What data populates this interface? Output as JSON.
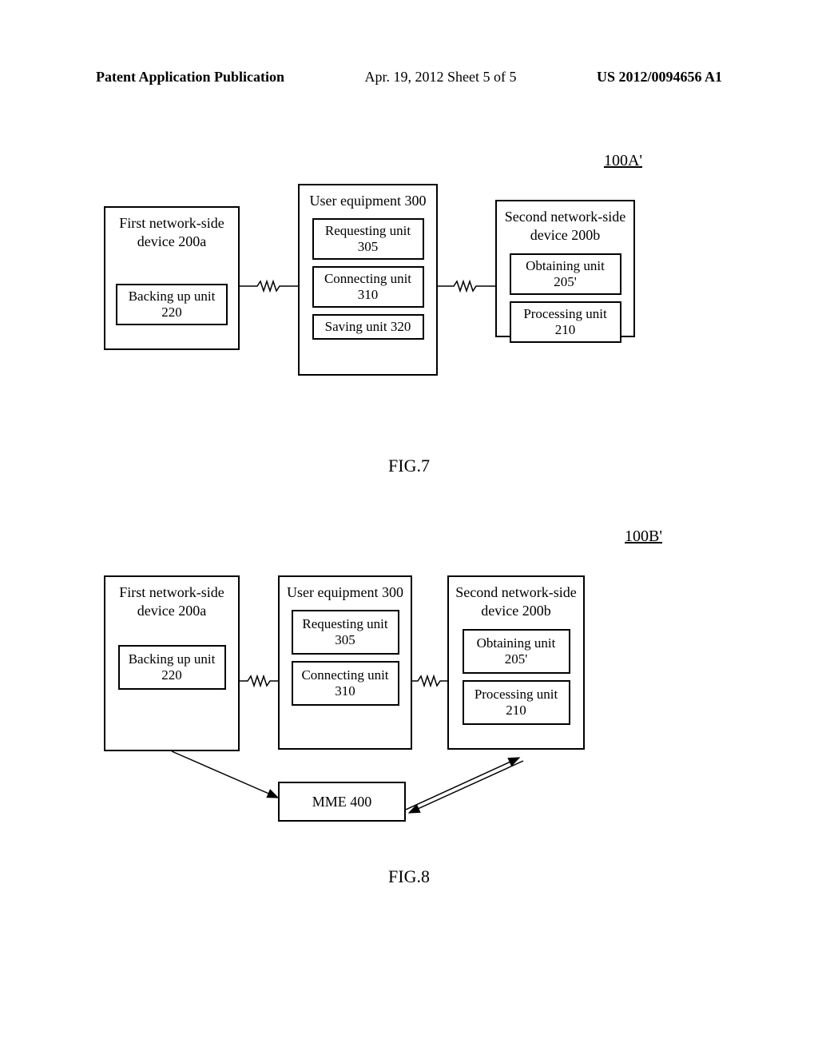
{
  "header": {
    "left": "Patent Application Publication",
    "mid": "Apr. 19, 2012  Sheet 5 of 5",
    "right": "US 2012/0094656 A1"
  },
  "systems": {
    "s1_label": "100A'",
    "s2_label": "100B'"
  },
  "fig7": {
    "caption": "FIG.7",
    "box1_title": "First network-side device 200a",
    "box1_unit1": "Backing up unit 220",
    "box2_title": "User equipment 300",
    "box2_unit1": "Requesting unit 305",
    "box2_unit2": "Connecting unit 310",
    "box2_unit3": "Saving unit 320",
    "box3_title": "Second network-side device 200b",
    "box3_unit1": "Obtaining unit 205'",
    "box3_unit2": "Processing unit 210"
  },
  "fig8": {
    "caption": "FIG.8",
    "box1_title": "First network-side device 200a",
    "box1_unit1": "Backing up unit 220",
    "box2_title": "User equipment 300",
    "box2_unit1": "Requesting unit 305",
    "box2_unit2": "Connecting unit 310",
    "box3_title": "Second network-side device 200b",
    "box3_unit1": "Obtaining unit 205'",
    "box3_unit2": "Processing unit 210",
    "mme": "MME 400"
  }
}
